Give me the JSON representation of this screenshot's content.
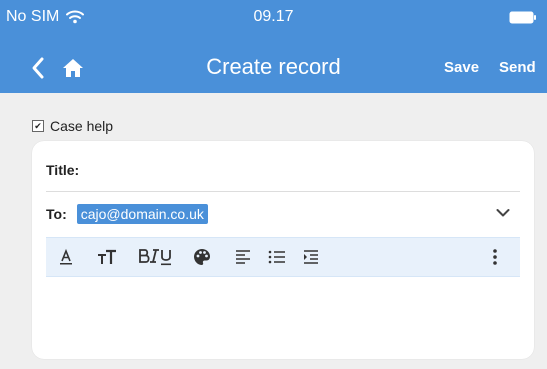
{
  "status_bar": {
    "carrier": "No SIM",
    "time": "09.17"
  },
  "nav": {
    "title": "Create record",
    "save_label": "Save",
    "send_label": "Send"
  },
  "form": {
    "case_help_label": "Case help",
    "case_help_checked": true,
    "title_label": "Title:",
    "title_value": "",
    "to_label": "To:",
    "to_value": "cajo@domain.co.uk"
  },
  "toolbar": {
    "buttons": [
      "font-color-icon",
      "text-size-icon",
      "bold-italic-underline-icon",
      "palette-icon",
      "align-left-icon",
      "bullet-list-icon",
      "indent-icon",
      "more-options-icon"
    ]
  },
  "colors": {
    "header": "#4a90d9",
    "background": "#efefef",
    "toolbar": "#e8f1fb",
    "chip": "#4a90d9"
  }
}
